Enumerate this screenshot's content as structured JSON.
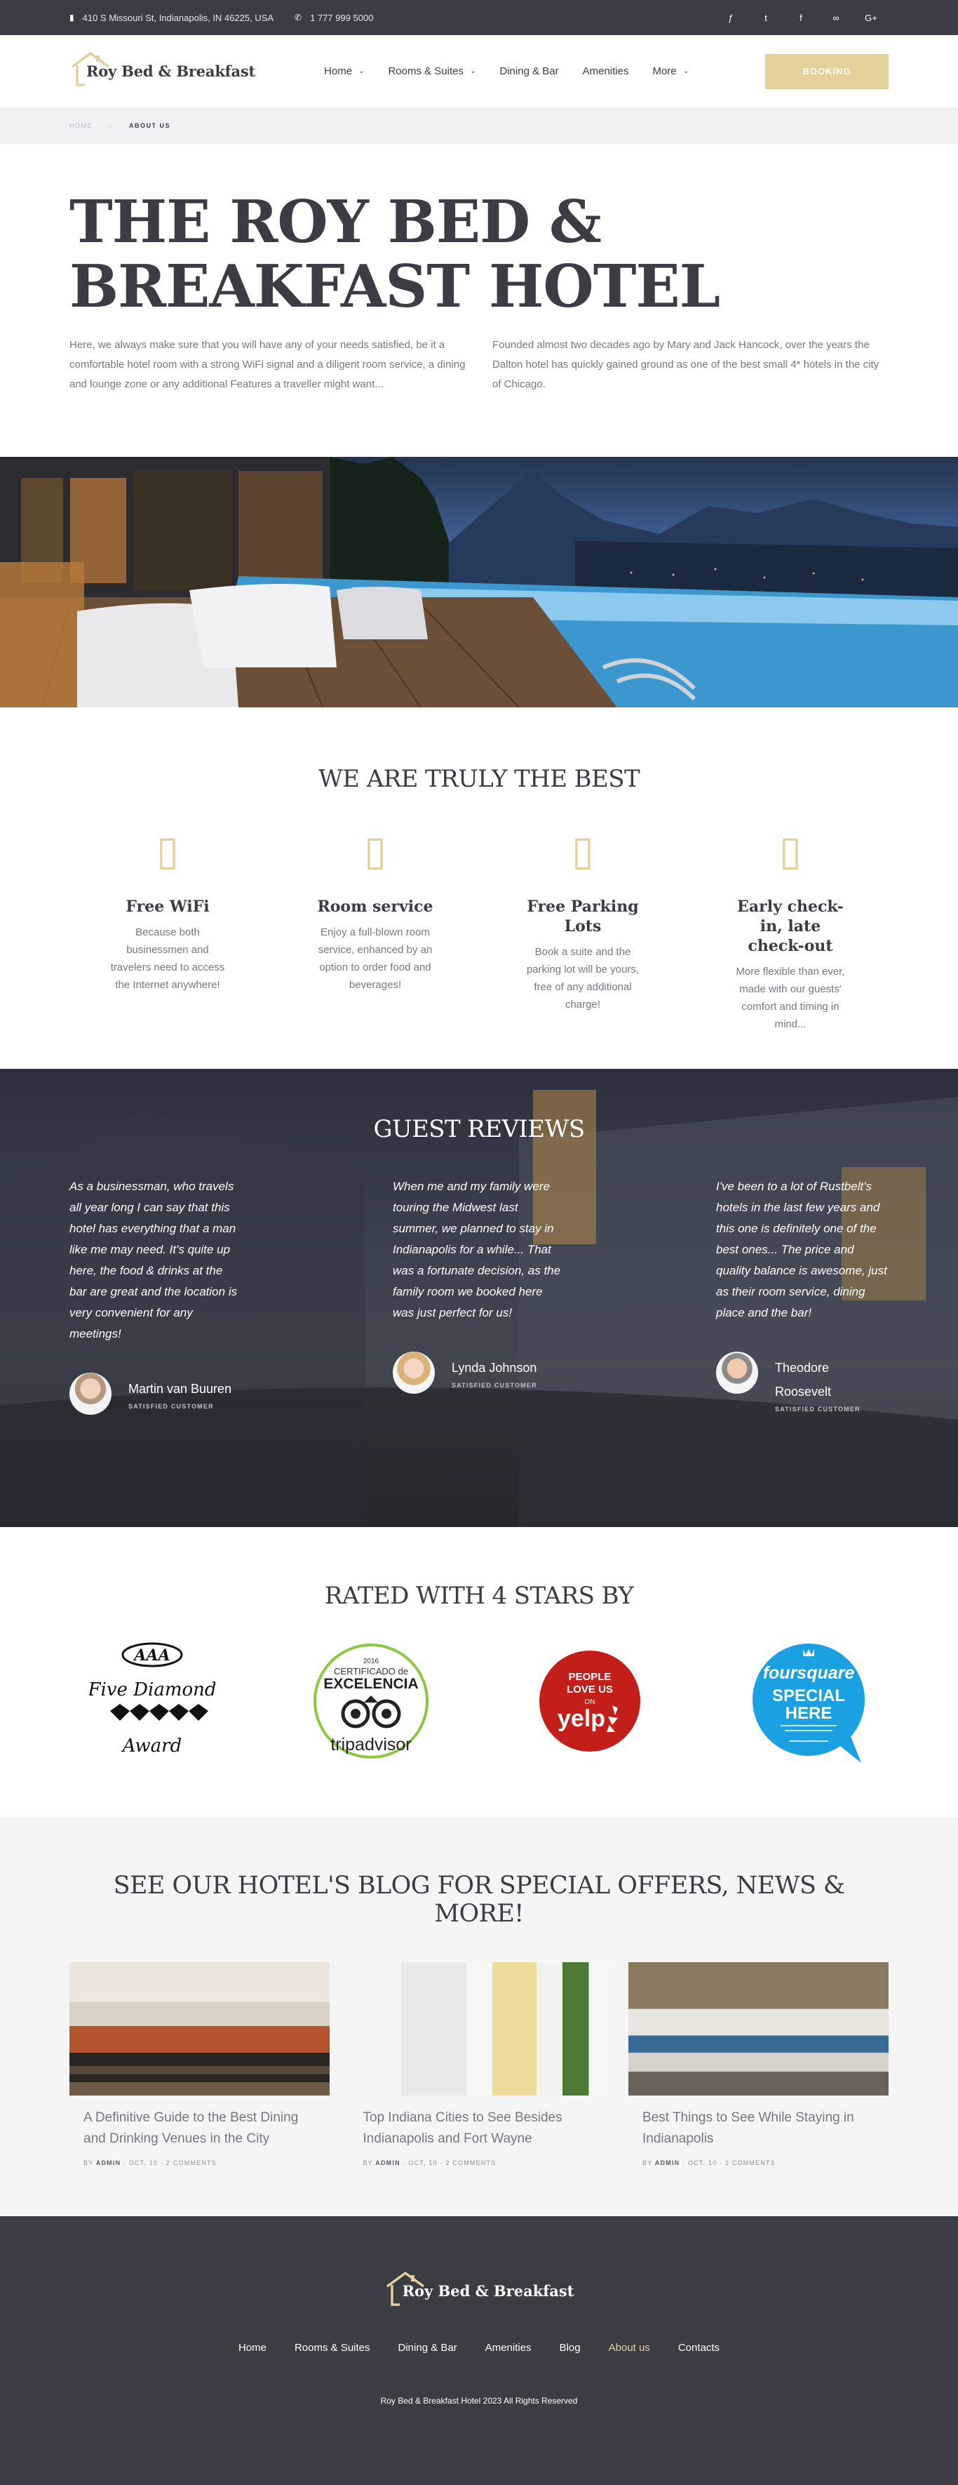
{
  "topbar": {
    "address_icon": "map-icon",
    "address": "410 S Missouri St, Indianapolis, IN 46225, USA",
    "phone_icon": "phone-icon",
    "phone": "1 777 999 5000",
    "social": [
      {
        "icon": "foursquare-icon",
        "glyph": "ƒ"
      },
      {
        "icon": "twitter-icon",
        "glyph": "t"
      },
      {
        "icon": "facebook-icon",
        "glyph": "f"
      },
      {
        "icon": "tripadvisor-icon",
        "glyph": "∞"
      },
      {
        "icon": "google-plus-icon",
        "glyph": "G+"
      }
    ]
  },
  "header": {
    "logo_text": "Roy Bed & Breakfast",
    "nav": [
      {
        "label": "Home",
        "dropdown": true
      },
      {
        "label": "Rooms & Suites",
        "dropdown": true
      },
      {
        "label": "Dining & Bar",
        "dropdown": false
      },
      {
        "label": "Amenities",
        "dropdown": false
      },
      {
        "label": "More",
        "dropdown": true
      }
    ],
    "booking_label": "Booking"
  },
  "breadcrumb": {
    "home": "Home",
    "current": "About us"
  },
  "intro": {
    "title": "THE ROY BED & BREAKFAST HOTEL",
    "col1": "Here, we always make sure that you will have any of your needs satisfied, be it a comfortable hotel room with a strong WiFi signal and a diligent room service, a dining and lounge zone or any additional Features a traveller might want...",
    "col2": "Founded almost two decades ago by Mary and Jack Hancock, over the years the Dalton hotel has quickly gained ground as one of the best small 4* hotels in the city of Chicago."
  },
  "features": {
    "title": "WE ARE TRULY THE BEST",
    "items": [
      {
        "icon": "wifi-icon",
        "title": "Free WiFi",
        "text": "Because both businessmen and travelers need to access the Internet anywhere!"
      },
      {
        "icon": "room-service-icon",
        "title": "Room service",
        "text": "Enjoy a full-blown room service, enhanced by an option to order food and beverages!"
      },
      {
        "icon": "parking-icon",
        "title": "Free Parking Lots",
        "text": "Book a suite and the parking lot will be yours, free of any additional charge!"
      },
      {
        "icon": "clock-icon",
        "title": "Early check-in, late check-out",
        "text": "More flexible than ever, made with our guests' comfort and timing in mind..."
      }
    ]
  },
  "reviews": {
    "title": "GUEST REVIEWS",
    "items": [
      {
        "quote": "As a businessman, who travels all year long I can say that this hotel has everything that a man like me may need. It's quite up here, the food & drinks at the bar are great and the location is very convenient for any meetings!",
        "name": "Martin van Buuren",
        "role": "Satisfied customer"
      },
      {
        "quote": "When me and my family were touring the Midwest last summer, we planned to stay in Indianapolis for a while... That was a fortunate decision, as the family room we booked here was just perfect for us!",
        "name": "Lynda Johnson",
        "role": "Satisfied customer"
      },
      {
        "quote": "I've been to a lot of Rustbelt's hotels in the last few years and this one is definitely one of the best ones... The price and quality balance is awesome, just as their room service, dining place and the bar!",
        "name": "Theodore Roosevelt",
        "role": "Satisfied customer"
      }
    ]
  },
  "rated": {
    "title": "RATED WITH 4 STARS BY",
    "aaa": {
      "top": "AAA",
      "line1": "Five Diamond",
      "line2": "Award"
    },
    "tripadvisor": {
      "year": "2016",
      "cert": "CERTIFICADO de",
      "exc": "EXCELENCIA",
      "brand": "tripadvisor"
    },
    "yelp": {
      "line1": "PEOPLE",
      "line2": "LOVE US",
      "on": "ON",
      "brand": "yelp"
    },
    "foursquare": {
      "brand": "foursquare",
      "line1": "SPECIAL",
      "line2": "HERE"
    }
  },
  "blog": {
    "title": "SEE OUR HOTEL'S BLOG FOR SPECIAL OFFERS, NEWS & MORE!",
    "posts": [
      {
        "title": "A Definitive Guide to the Best Dining and Drinking Venues in the City",
        "by": "By",
        "author": "Admin",
        "date": "Oct, 10",
        "comments": "2 Comments"
      },
      {
        "title": "Top Indiana Cities to See Besides Indianapolis and Fort Wayne",
        "by": "By",
        "author": "Admin",
        "date": "Oct, 10",
        "comments": "2 Comments"
      },
      {
        "title": "Best Things to See While Staying in Indianapolis",
        "by": "By",
        "author": "Admin",
        "date": "Oct, 10",
        "comments": "2 Comments"
      }
    ]
  },
  "footer": {
    "logo_text": "Roy Bed & Breakfast",
    "nav": [
      "Home",
      "Rooms & Suites",
      "Dining & Bar",
      "Amenities",
      "Blog",
      "About us",
      "Contacts"
    ],
    "active_index": 5,
    "copyright": "Roy Bed & Breakfast Hotel 2023 All Rights Reserved"
  },
  "colors": {
    "accent": "#e3d09b",
    "dark": "#3c3c44"
  }
}
